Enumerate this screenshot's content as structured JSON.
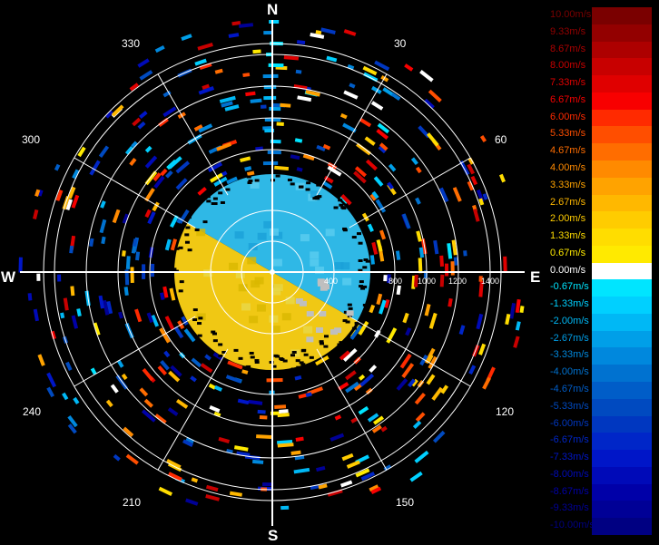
{
  "directions": {
    "n": "N",
    "e": "E",
    "s": "S",
    "w": "W"
  },
  "bearings": [
    "30",
    "60",
    "120",
    "150",
    "210",
    "240",
    "300",
    "330"
  ],
  "range_ticks": [
    "400",
    "800",
    "1000",
    "1200",
    "1400"
  ],
  "legend": {
    "items": [
      {
        "label": "10.00m/s",
        "color": "#7a0000"
      },
      {
        "label": "9.33m/s",
        "color": "#930000"
      },
      {
        "label": "8.67m/s",
        "color": "#ad0000"
      },
      {
        "label": "8.00m/s",
        "color": "#c80000"
      },
      {
        "label": "7.33m/s",
        "color": "#e00000"
      },
      {
        "label": "6.67m/s",
        "color": "#f80000"
      },
      {
        "label": "6.00m/s",
        "color": "#ff2a00"
      },
      {
        "label": "5.33m/s",
        "color": "#ff4e00"
      },
      {
        "label": "4.67m/s",
        "color": "#ff6d00"
      },
      {
        "label": "4.00m/s",
        "color": "#ff8a00"
      },
      {
        "label": "3.33m/s",
        "color": "#ffa300"
      },
      {
        "label": "2.67m/s",
        "color": "#ffb800"
      },
      {
        "label": "2.00m/s",
        "color": "#ffcc00"
      },
      {
        "label": "1.33m/s",
        "color": "#ffdd00"
      },
      {
        "label": "0.67m/s",
        "color": "#ffea00"
      },
      {
        "label": "0.00m/s",
        "color": "#ffffff"
      },
      {
        "label": "-0.67m/s",
        "color": "#00e5ff"
      },
      {
        "label": "-1.33m/s",
        "color": "#00d0ff"
      },
      {
        "label": "-2.00m/s",
        "color": "#00b8f5"
      },
      {
        "label": "-2.67m/s",
        "color": "#009fe8"
      },
      {
        "label": "-3.33m/s",
        "color": "#0088dd"
      },
      {
        "label": "-4.00m/s",
        "color": "#0072d0"
      },
      {
        "label": "-4.67m/s",
        "color": "#005dc8"
      },
      {
        "label": "-5.33m/s",
        "color": "#004ac0"
      },
      {
        "label": "-6.00m/s",
        "color": "#0037c0"
      },
      {
        "label": "-6.67m/s",
        "color": "#0026c8"
      },
      {
        "label": "-7.33m/s",
        "color": "#0016c8"
      },
      {
        "label": "-8.00m/s",
        "color": "#000ab8"
      },
      {
        "label": "-8.67m/s",
        "color": "#0000a8"
      },
      {
        "label": "-9.33m/s",
        "color": "#000096"
      },
      {
        "label": "-10.00m/s",
        "color": "#000082"
      }
    ]
  }
}
